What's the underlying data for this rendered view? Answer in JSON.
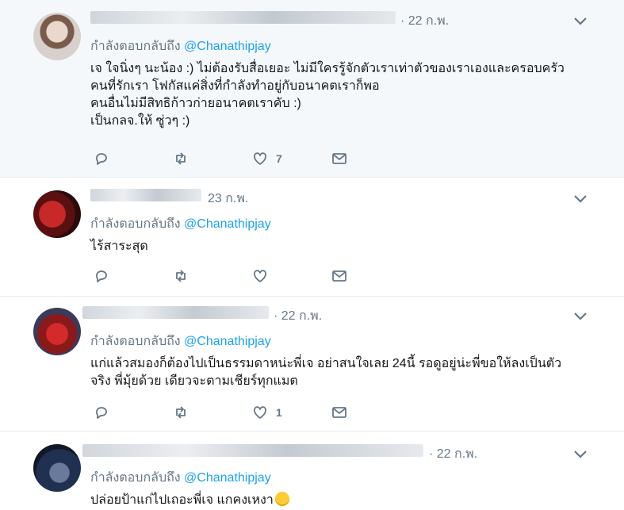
{
  "tweets": [
    {
      "time": "· 22 ก.พ.",
      "reply_prefix": "กำลังตอบกลับถึง",
      "reply_handle": "@Chanathipjay",
      "lines": [
        "เจ ใจนิ่งๆ นะน้อง :) ไม่ต้องรับสื่อเยอะ ไม่มีใครรู้จักตัวเราเท่าตัวของเราเองและครอบครัว",
        "คนที่รักเรา โฟกัสแค่สิ่งที่กำลังทำอยู่กับอนาคตเราก็พอ",
        "คนอื่นไม่มีสิทธิก้าวก่ายอนาคตเราคับ :)",
        "เป็นกลจ.ให้ ซู่วๆ :)"
      ],
      "like_count": "7"
    },
    {
      "time": "23 ก.พ.",
      "reply_prefix": "กำลังตอบกลับถึง",
      "reply_handle": "@Chanathipjay",
      "lines": [
        "ไร้สาระสุด"
      ],
      "like_count": ""
    },
    {
      "time": "· 22 ก.พ.",
      "reply_prefix": "กำลังตอบกลับถึง",
      "reply_handle": "@Chanathipjay",
      "lines": [
        "แก่แล้วสมองก็ต้องไปเป็นธรรมดาหน่ะพี่เจ อย่าสนใจเลย 24นี้ รอดูอยู่น่ะพี่ขอให้ลงเป็นตัว",
        "จริง พี่มุ้ยด้วย เดียวจะตามเชียร์ทุกแมต"
      ],
      "like_count": "1"
    },
    {
      "time": "· 22 ก.พ.",
      "reply_prefix": "กำลังตอบกลับถึง",
      "reply_handle": "@Chanathipjay",
      "lines": [
        "ปล่อยป้าแก่ไปเถอะพี่เจ แกคงเหงา"
      ],
      "like_count": ""
    }
  ],
  "icons": [
    "reply-icon",
    "retweet-icon",
    "heart-icon",
    "direct-message-icon",
    "chevron-down-icon",
    "sweat-smile-emoji"
  ],
  "colors": {
    "link": "#1da1f2",
    "muted": "#657786",
    "highlight_bg": "#f5f8fa",
    "border": "#e6ecf0"
  }
}
